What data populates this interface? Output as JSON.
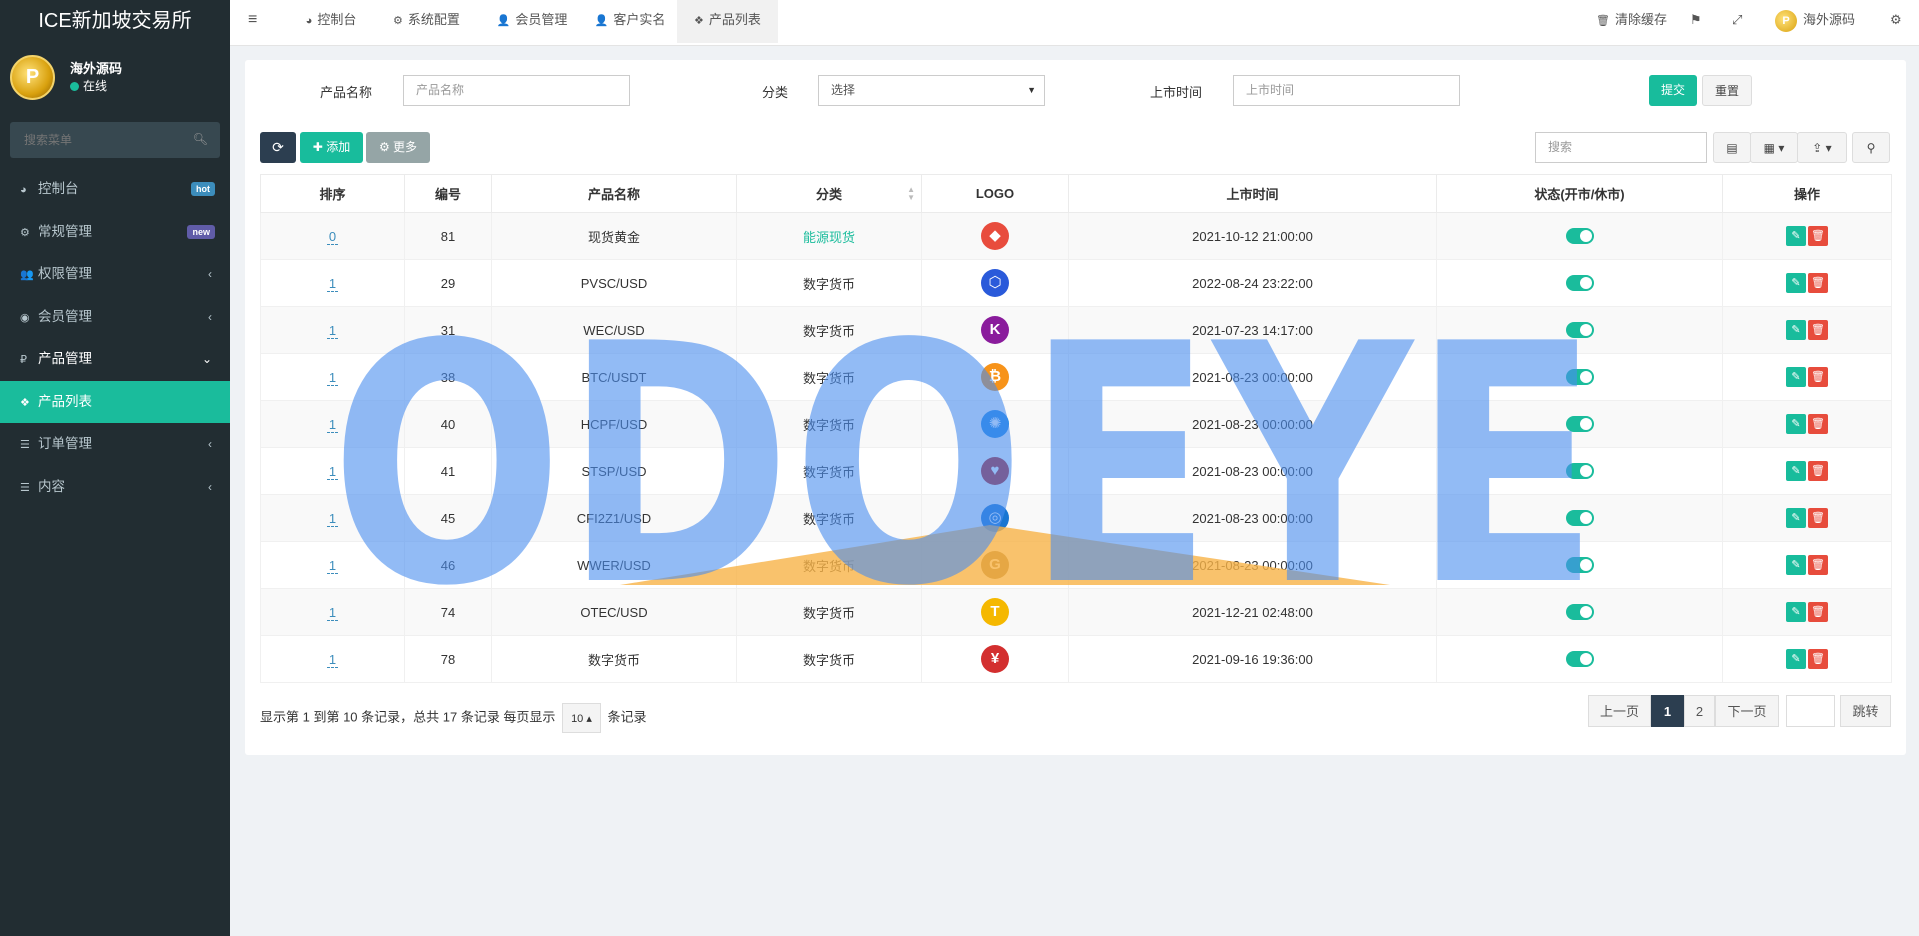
{
  "brand": "ICE新加坡交易所",
  "user": {
    "name": "海外源码",
    "status": "在线",
    "avatar_letter": "P"
  },
  "search": {
    "placeholder": "搜索菜单"
  },
  "menu": [
    {
      "label": "控制台",
      "icon": "dashboard-icon",
      "glyph": "◕",
      "badge": "hot",
      "badge_color": "#3c8dbc"
    },
    {
      "label": "常规管理",
      "icon": "cogs-icon",
      "glyph": "⚙",
      "badge": "new",
      "badge_color": "#605ca8"
    },
    {
      "label": "权限管理",
      "icon": "group-icon",
      "glyph": "👥",
      "chev": "‹"
    },
    {
      "label": "会员管理",
      "icon": "user-circle-icon",
      "glyph": "◉",
      "chev": "‹"
    },
    {
      "label": "产品管理",
      "icon": "product-icon",
      "glyph": "₽",
      "chev": "⌄",
      "open": true
    },
    {
      "label": "产品列表",
      "icon": "cubes-icon",
      "glyph": "❖",
      "active": true
    },
    {
      "label": "订单管理",
      "icon": "list-icon",
      "glyph": "☰",
      "chev": "‹"
    },
    {
      "label": "内容",
      "icon": "list-icon",
      "glyph": "☰",
      "chev": "‹"
    }
  ],
  "topnav": {
    "toggle": "≡",
    "tabs": [
      {
        "label": "控制台",
        "glyph": "◕"
      },
      {
        "label": "系统配置",
        "glyph": "⚙"
      },
      {
        "label": "会员管理",
        "glyph": "👤"
      },
      {
        "label": "客户实名",
        "glyph": "👤"
      },
      {
        "label": "产品列表",
        "glyph": "❖",
        "active": true
      }
    ],
    "clear_cache": "清除缓存",
    "username": "海外源码"
  },
  "filter": {
    "name_label": "产品名称",
    "name_placeholder": "产品名称",
    "category_label": "分类",
    "category_value": "选择",
    "date_label": "上市时间",
    "date_placeholder": "上市时间",
    "submit": "提交",
    "reset": "重置"
  },
  "toolbar": {
    "add": "添加",
    "more": "更多",
    "search_placeholder": "搜索"
  },
  "table": {
    "headers": [
      "排序",
      "编号",
      "产品名称",
      "分类",
      "LOGO",
      "上市时间",
      "状态(开市/休市)",
      "操作"
    ],
    "rows": [
      {
        "sort": "0",
        "id": "81",
        "name": "现货黄金",
        "category": "能源现货",
        "highlight": true,
        "logo": "gold-logo-icon",
        "logo_color": "#e84c3d",
        "logo_glyph": "◆",
        "date": "2021-10-12 21:00:00"
      },
      {
        "sort": "1",
        "id": "29",
        "name": "PVSC/USD",
        "category": "数字货币",
        "logo": "chainlink-hexagon-icon",
        "logo_color": "#2a5ada",
        "logo_glyph": "⬡",
        "date": "2022-08-24 23:22:00"
      },
      {
        "sort": "1",
        "id": "31",
        "name": "WEC/USD",
        "category": "数字货币",
        "logo": "k-letter-icon",
        "logo_color": "#8a1c9c",
        "logo_glyph": "K",
        "date": "2021-07-23 14:17:00"
      },
      {
        "sort": "1",
        "id": "38",
        "name": "BTC/USDT",
        "category": "数字货币",
        "logo": "bitcoin-icon",
        "logo_color": "#f7931a",
        "logo_glyph": "₿",
        "date": "2021-08-23 00:00:00"
      },
      {
        "sort": "1",
        "id": "40",
        "name": "HCPF/USD",
        "category": "数字货币",
        "logo": "gear-badge-icon",
        "logo_color": "#1e88e5",
        "logo_glyph": "✺",
        "date": "2021-08-23 00:00:00"
      },
      {
        "sort": "1",
        "id": "41",
        "name": "STSP/USD",
        "category": "数字货币",
        "logo": "heart-shield-icon",
        "logo_color": "#b71c1c",
        "logo_glyph": "♥",
        "date": "2021-08-23 00:00:00"
      },
      {
        "sort": "1",
        "id": "45",
        "name": "CFI2Z1/USD",
        "category": "数字货币",
        "logo": "ring-coin-icon",
        "logo_color": "#1976d2",
        "logo_glyph": "◎",
        "date": "2021-08-23 00:00:00"
      },
      {
        "sort": "1",
        "id": "46",
        "name": "WWER/USD",
        "category": "数字货币",
        "logo": "g-coin-icon",
        "logo_color": "#9e7b3a",
        "logo_glyph": "G",
        "date": "2021-08-23 00:00:00"
      },
      {
        "sort": "1",
        "id": "74",
        "name": "OTEC/USD",
        "category": "数字货币",
        "logo": "t-letter-icon",
        "logo_color": "#f5b800",
        "logo_glyph": "T",
        "date": "2021-12-21 02:48:00"
      },
      {
        "sort": "1",
        "id": "78",
        "name": "数字货币",
        "category": "数字货币",
        "logo": "yuan-coin-icon",
        "logo_color": "#d32f2f",
        "logo_glyph": "¥",
        "date": "2021-09-16 19:36:00"
      }
    ]
  },
  "pagination": {
    "summary_pre": "显示第 1 到第 10 条记录，总共 17 条记录 每页显示",
    "page_size": "10",
    "summary_post": "条记录",
    "prev": "上一页",
    "pages": [
      "1",
      "2"
    ],
    "next": "下一页",
    "jump": "跳转"
  },
  "watermark": {
    "text": "ODOEYE"
  },
  "colors": {
    "accent": "#1abc9c",
    "sidebar": "#222d32",
    "dark_button": "#2c3e50",
    "delete": "#e74c3c"
  }
}
